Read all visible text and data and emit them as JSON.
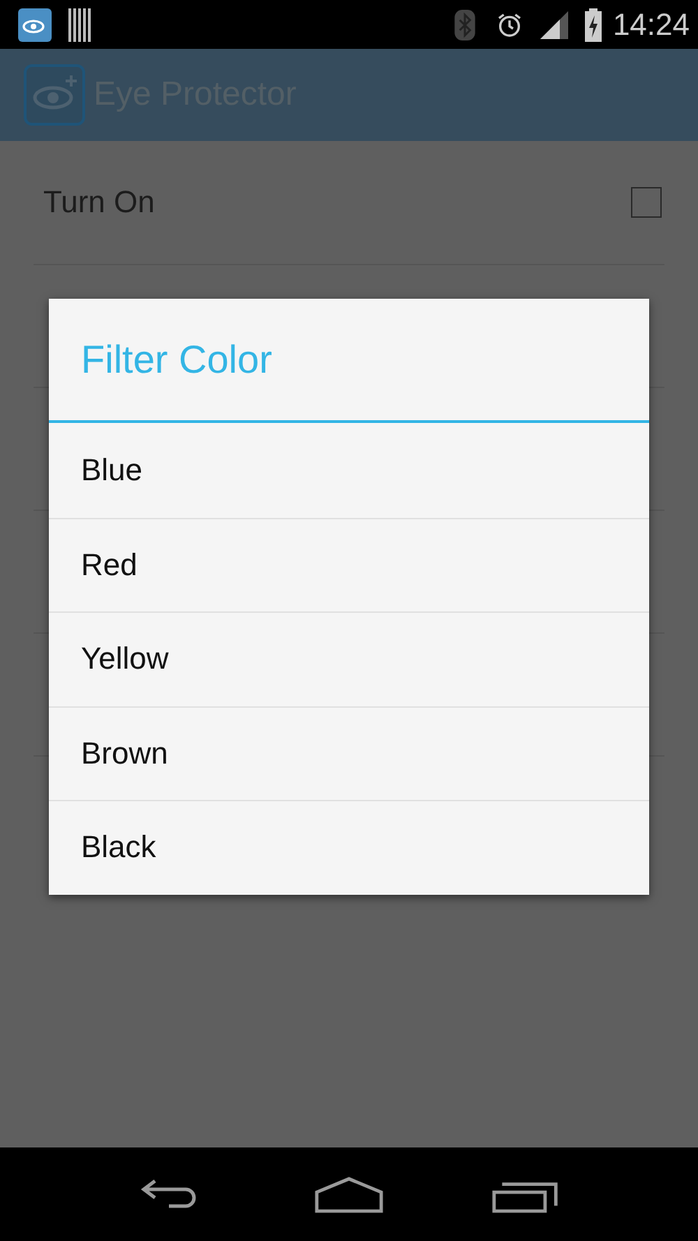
{
  "status_bar": {
    "time": "14:24"
  },
  "app_bar": {
    "title": "Eye Protector"
  },
  "settings": [
    {
      "kind": "checkbox",
      "label": "Turn On",
      "checked": false
    },
    {
      "kind": "hidden"
    },
    {
      "kind": "hidden"
    },
    {
      "kind": "hidden"
    },
    {
      "kind": "hidden"
    }
  ],
  "dialog": {
    "title": "Filter Color",
    "options": [
      "Blue",
      "Red",
      "Yellow",
      "Brown",
      "Black"
    ]
  }
}
